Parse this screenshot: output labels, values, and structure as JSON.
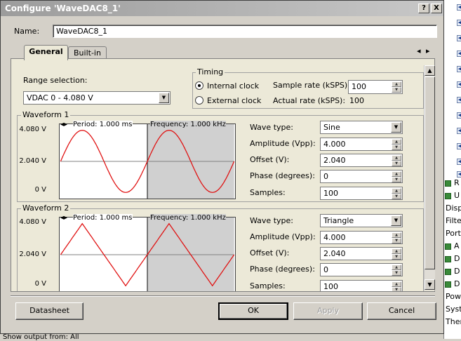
{
  "window": {
    "title": "Configure 'WaveDAC8_1'",
    "help_button": "?",
    "close_button": "X"
  },
  "name_label": "Name:",
  "name_value": "WaveDAC8_1",
  "tabs": [
    {
      "label": "General",
      "active": true
    },
    {
      "label": "Built-in",
      "active": false
    }
  ],
  "tab_nav": {
    "left": "◂",
    "right": "▸"
  },
  "range": {
    "label": "Range selection:",
    "value": "VDAC 0 - 4.080 V"
  },
  "timing": {
    "title": "Timing",
    "internal_clock": "Internal clock",
    "external_clock": "External clock",
    "selected": "internal",
    "sample_rate_label": "Sample rate (kSPS):",
    "sample_rate_value": "100",
    "actual_rate_label": "Actual rate (kSPS):",
    "actual_rate_value": "100"
  },
  "waveform1": {
    "title": "Waveform 1",
    "period_text": "Period: 1.000 ms",
    "frequency_text": "Frequency: 1.000 kHz",
    "y_ticks": [
      "4.080 V",
      "2.040 V",
      "0 V"
    ],
    "wave_type_label": "Wave type:",
    "wave_type_value": "Sine",
    "amplitude_label": "Amplitude (Vpp):",
    "amplitude_value": "4.000",
    "offset_label": "Offset (V):",
    "offset_value": "2.040",
    "phase_label": "Phase (degrees):",
    "phase_value": "0",
    "samples_label": "Samples:",
    "samples_value": "100"
  },
  "waveform2": {
    "title": "Waveform 2",
    "period_text": "Period: 1.000 ms",
    "frequency_text": "Frequency: 1.000 kHz",
    "y_ticks": [
      "4.080 V",
      "2.040 V",
      "0 V"
    ],
    "wave_type_label": "Wave type:",
    "wave_type_value": "Triangle",
    "amplitude_label": "Amplitude (Vpp):",
    "amplitude_value": "4.000",
    "offset_label": "Offset (V):",
    "offset_value": "2.040",
    "phase_label": "Phase (degrees):",
    "phase_value": "0",
    "samples_label": "Samples:",
    "samples_value": "100"
  },
  "buttons": {
    "datasheet": "Datasheet",
    "ok": "OK",
    "apply": "Apply",
    "cancel": "Cancel"
  },
  "background": {
    "side_texts": [
      "R",
      "U",
      "Displ",
      "Filter",
      "Ports",
      "A",
      "D",
      "D",
      "D",
      "Powe",
      "Syste",
      "Therm"
    ],
    "bottom_text": "Show output from:  All"
  },
  "colors": {
    "wave": "#e01010",
    "shade": "#d0d0d0",
    "accent": "#1c3f8c"
  }
}
